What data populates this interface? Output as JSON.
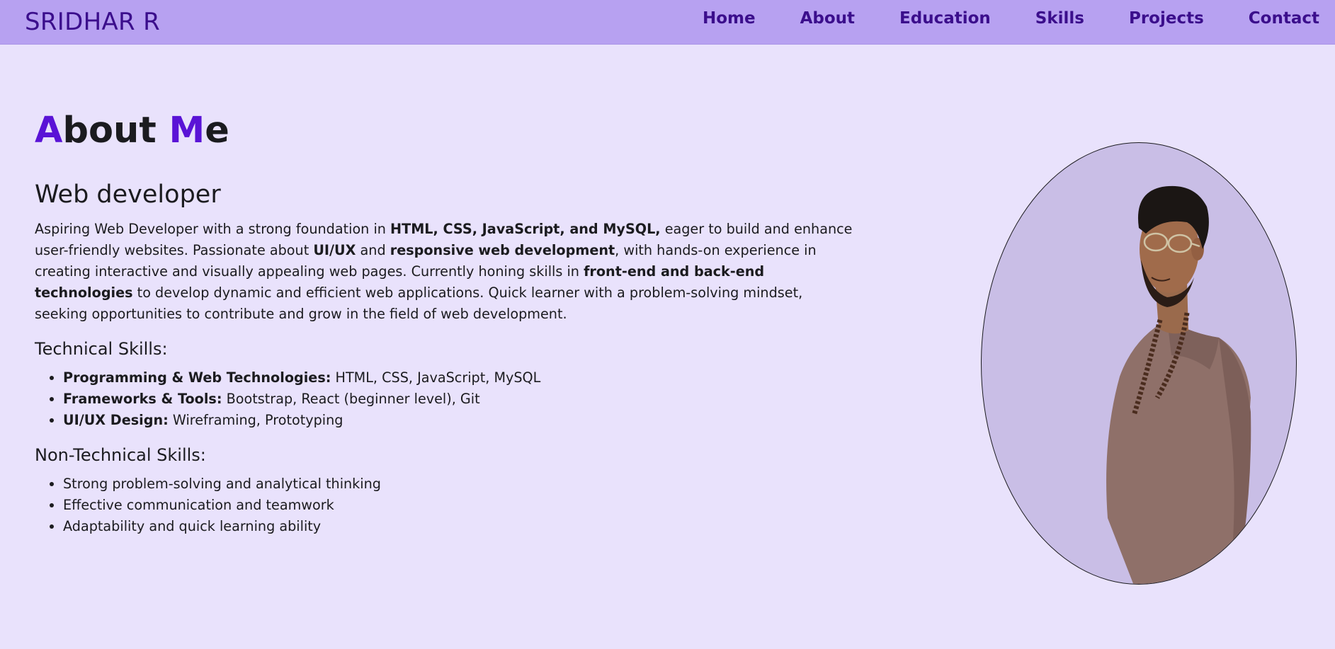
{
  "header": {
    "brand": "SRIDHAR R",
    "nav": [
      "Home",
      "About",
      "Education",
      "Skills",
      "Projects",
      "Contact"
    ]
  },
  "about": {
    "title_first_initial": "A",
    "title_first_rest": "bout",
    "title_second_initial": "M",
    "title_second_rest": "e",
    "role": "Web developer",
    "bio": {
      "p1": "Aspiring Web Developer with a strong foundation in ",
      "b1": "HTML, CSS, JavaScript, and MySQL,",
      "p2": " eager to build and enhance user-friendly websites. Passionate about ",
      "b2": "UI/UX",
      "p3": " and ",
      "b3": "responsive web development",
      "p4": ", with hands-on experience in creating interactive and visually appealing web pages. Currently honing skills in ",
      "b4": "front-end and back-end technologies",
      "p5": " to develop dynamic and efficient web applications. Quick learner with a problem-solving mindset, seeking opportunities to contribute and grow in the field of web development."
    },
    "technical_title": "Technical Skills:",
    "technical_skills": [
      {
        "label": "Programming & Web Technologies:",
        "value": " HTML, CSS, JavaScript, MySQL"
      },
      {
        "label": "Frameworks & Tools:",
        "value": " Bootstrap, React (beginner level), Git"
      },
      {
        "label": "UI/UX Design:",
        "value": " Wireframing, Prototyping"
      }
    ],
    "non_technical_title": "Non-Technical Skills:",
    "non_technical_skills": [
      "Strong problem-solving and analytical thinking",
      "Effective communication and teamwork",
      "Adaptability and quick learning ability"
    ]
  },
  "colors": {
    "page_bg": "#e9e2fc",
    "navbar_bg": "#b7a1f1",
    "nav_text": "#3b0e8c",
    "accent": "#5a13d6",
    "portrait_bg": "#c9bee6"
  }
}
